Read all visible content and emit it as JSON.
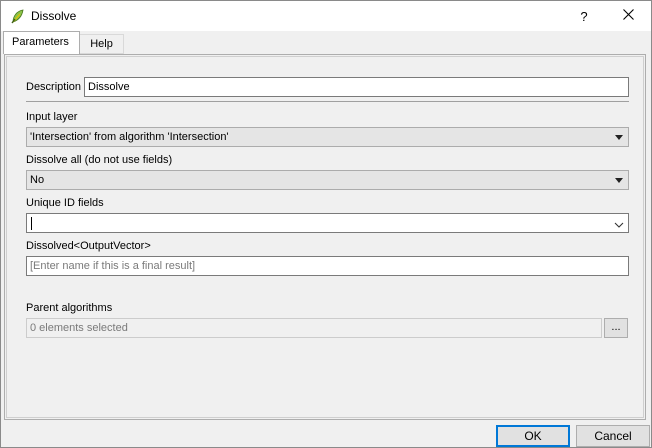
{
  "window": {
    "title": "Dissolve",
    "help_glyph": "?",
    "icons": {
      "app": "qgis-leaf-icon",
      "close": "close-icon"
    }
  },
  "tabs": [
    {
      "label": "Parameters",
      "active": true
    },
    {
      "label": "Help",
      "active": false
    }
  ],
  "form": {
    "description_label": "Description",
    "description_value": "Dissolve",
    "input_layer_label": "Input layer",
    "input_layer_value": "'Intersection' from algorithm 'Intersection'",
    "dissolve_all_label": "Dissolve all (do not use fields)",
    "dissolve_all_value": "No",
    "unique_id_label": "Unique ID fields",
    "unique_id_value": "",
    "output_label": "Dissolved<OutputVector>",
    "output_placeholder": "[Enter name if this is a final result]",
    "parent_algorithms_label": "Parent algorithms",
    "parent_algorithms_value": "0 elements selected",
    "browse_label": "..."
  },
  "buttons": {
    "ok": "OK",
    "cancel": "Cancel"
  },
  "colors": {
    "accent": "#0078d7",
    "panel_bg": "#f0f0f0",
    "combo_bg": "#e5e5e5"
  }
}
